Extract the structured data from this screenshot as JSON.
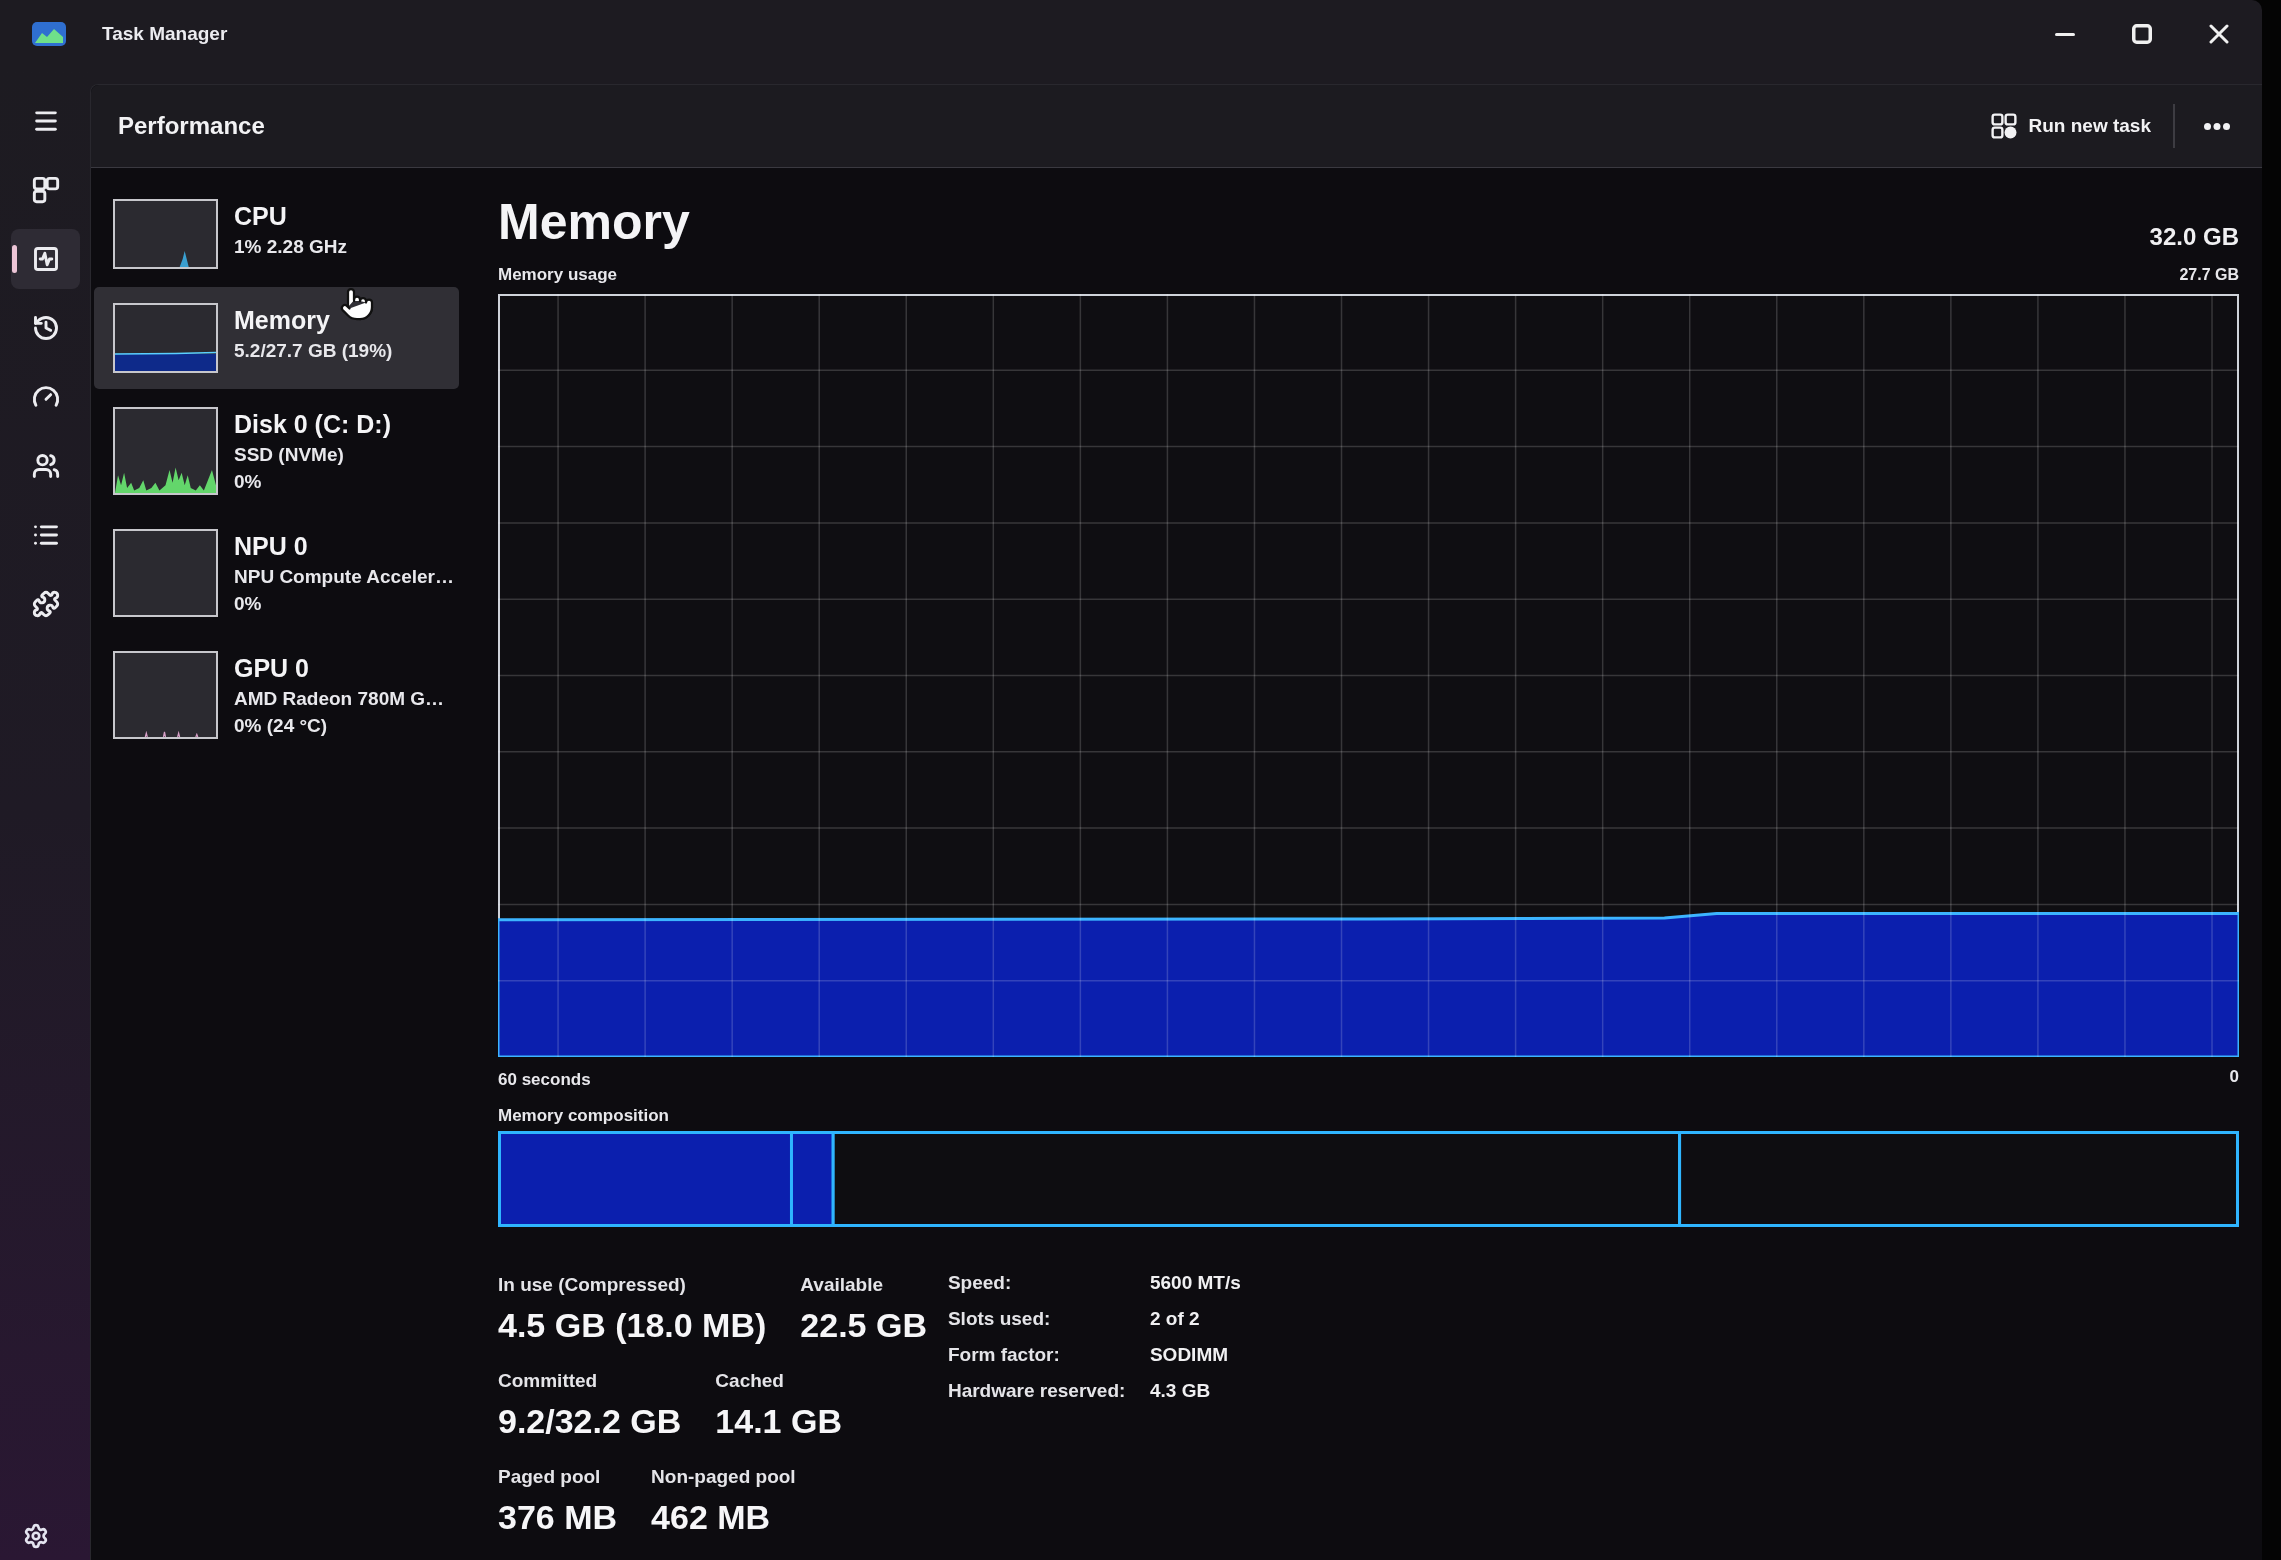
{
  "window": {
    "title": "Task Manager"
  },
  "nav_items": [
    {
      "kind": "processes",
      "selected": false
    },
    {
      "kind": "performance",
      "selected": true
    },
    {
      "kind": "history",
      "selected": false
    },
    {
      "kind": "startup",
      "selected": false
    },
    {
      "kind": "users",
      "selected": false
    },
    {
      "kind": "details",
      "selected": false
    },
    {
      "kind": "services",
      "selected": false
    }
  ],
  "header": {
    "title": "Performance",
    "run_new_task": "Run new task"
  },
  "devices": [
    {
      "kind": "cpu",
      "name": "CPU",
      "details": [
        "1% 2.28 GHz"
      ],
      "selected": false
    },
    {
      "kind": "memory",
      "name": "Memory",
      "details": [
        "5.2/27.7 GB (19%)"
      ],
      "selected": true
    },
    {
      "kind": "disk",
      "name": "Disk 0 (C: D:)",
      "details": [
        "SSD (NVMe)",
        "0%"
      ],
      "selected": false
    },
    {
      "kind": "npu",
      "name": "NPU 0",
      "details": [
        "NPU Compute Acceler…",
        "0%"
      ],
      "selected": false
    },
    {
      "kind": "gpu",
      "name": "GPU 0",
      "details": [
        "AMD Radeon 780M G…",
        "0% (24 °C)"
      ],
      "selected": false
    }
  ],
  "detail": {
    "title": "Memory",
    "capacity": "32.0 GB",
    "usage_graph": {
      "title": "Memory usage",
      "max_label": "27.7 GB",
      "start_label": "60 seconds",
      "end_label": "0"
    },
    "composition_label": "Memory composition",
    "stat_rows": [
      {
        "items": [
          {
            "label": "In use (Compressed)",
            "value": "4.5 GB (18.0 MB)"
          },
          {
            "label": "Available",
            "value": "22.5 GB"
          }
        ]
      },
      {
        "items": [
          {
            "label": "Committed",
            "value": "9.2/32.2 GB"
          },
          {
            "label": "Cached",
            "value": "14.1 GB"
          }
        ]
      },
      {
        "items": [
          {
            "label": "Paged pool",
            "value": "376 MB"
          },
          {
            "label": "Non-paged pool",
            "value": "462 MB"
          }
        ]
      }
    ],
    "properties": [
      {
        "label": "Speed:",
        "value": "5600 MT/s"
      },
      {
        "label": "Slots used:",
        "value": "2 of 2"
      },
      {
        "label": "Form factor:",
        "value": "SODIMM"
      },
      {
        "label": "Hardware reserved:",
        "value": "4.3 GB"
      }
    ]
  }
}
